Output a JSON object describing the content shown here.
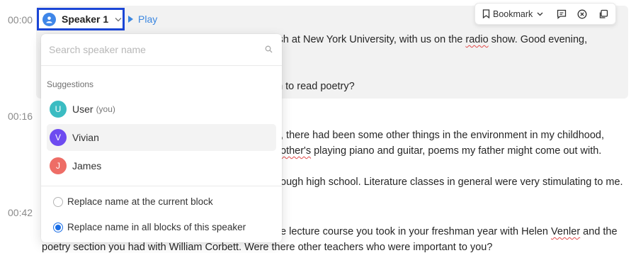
{
  "timestamps": [
    "00:00",
    "00:16",
    "00:42"
  ],
  "speaker_chip": {
    "name": "Speaker 1"
  },
  "play": {
    "label": "Play"
  },
  "toolbar": {
    "bookmark_label": "Bookmark"
  },
  "transcript": {
    "line1": "glish at New York University, with us on the ",
    "line1_mark": "radio",
    "line1_end": " show. Good evening,",
    "line2": "an to read poetry?",
    "line3": ", there had been some other things in the environment in my childhood,",
    "line4_mark": "other's",
    "line4": " playing piano and guitar, poems my father might come out with.",
    "line5": "ough high school. Literature classes in general were very stimulating to me.",
    "line6": "e lecture course you took in your freshman year with Helen ",
    "line6_mark": "Venler",
    "line6_end": " and the",
    "line7": "poetry section you had with William Corbett. Were there other teachers who were important to you?"
  },
  "dropdown": {
    "search_placeholder": "Search speaker name",
    "suggestions_label": "Suggestions",
    "options": [
      {
        "initial": "U",
        "name": "User",
        "note": "(you)",
        "color": "#3bbcc2"
      },
      {
        "initial": "V",
        "name": "Vivian",
        "note": "",
        "color": "#6d4bf0"
      },
      {
        "initial": "J",
        "name": "James",
        "note": "",
        "color": "#ee6d66"
      }
    ],
    "radio_current": "Replace name at the current block",
    "radio_all": "Replace name in all blocks of this speaker"
  },
  "colors": {
    "accent": "#1a6ee6",
    "chip_border": "#1b46d6",
    "play": "#3a86e0"
  }
}
